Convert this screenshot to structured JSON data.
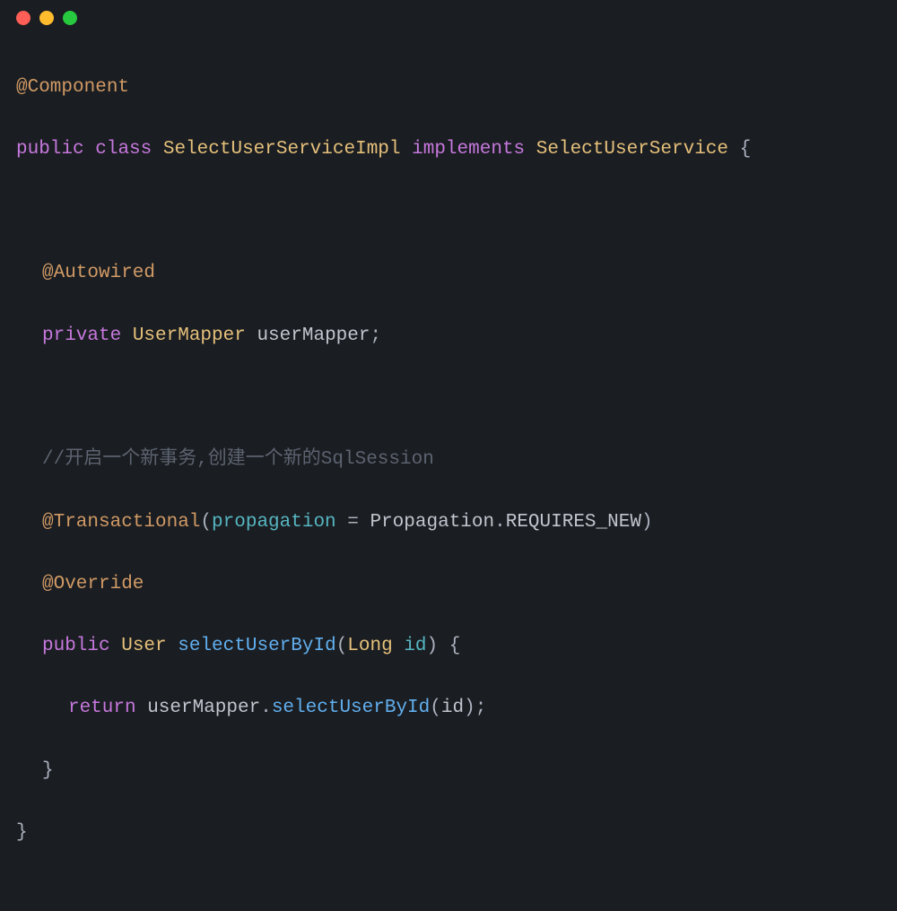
{
  "window": {
    "traffic_lights": {
      "red": "#ff5f56",
      "yellow": "#ffbd2e",
      "green": "#27c93f"
    }
  },
  "code": {
    "line1": {
      "annotation": "@Component"
    },
    "line2": {
      "kw_public": "public",
      "kw_class": "class",
      "classname": "SelectUserServiceImpl",
      "kw_implements": "implements",
      "interface": "SelectUserService",
      "brace": " {"
    },
    "line3": "",
    "line4": {
      "annotation": "@Autowired"
    },
    "line5": {
      "kw_private": "private",
      "type": "UserMapper",
      "field": "userMapper",
      "semi": ";"
    },
    "line6": "",
    "line7": {
      "comment": "//开启一个新事务,创建一个新的SqlSession"
    },
    "line8": {
      "annotation": "@Transactional",
      "paren_open": "(",
      "arg_name": "propagation ",
      "equals": "=",
      "arg_val": " Propagation",
      "dot": ".",
      "enum_val": "REQUIRES_NEW",
      "paren_close": ")"
    },
    "line9": {
      "annotation": "@Override"
    },
    "line10": {
      "kw_public": "public",
      "rettype": "User",
      "method": "selectUserById",
      "paren_open": "(",
      "paramtype": "Long",
      "paramname": " id",
      "paren_close": ")",
      "brace": " {"
    },
    "line11": {
      "kw_return": "return",
      "obj": " userMapper",
      "dot": ".",
      "call": "selectUserById",
      "paren_open": "(",
      "arg": "id",
      "paren_close": ")",
      "semi": ";"
    },
    "line12": {
      "brace": "}"
    },
    "line13": {
      "brace": "}"
    }
  }
}
